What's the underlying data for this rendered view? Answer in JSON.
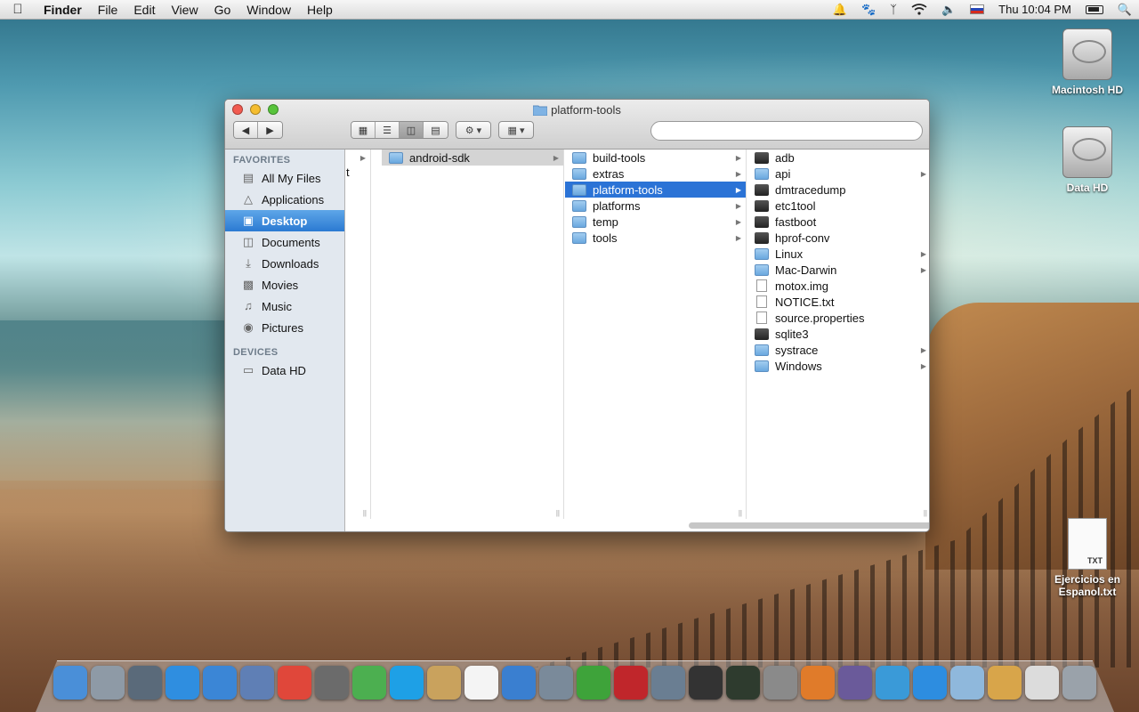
{
  "menubar": {
    "app_name": "Finder",
    "menus": [
      "File",
      "Edit",
      "View",
      "Go",
      "Window",
      "Help"
    ],
    "clock": "Thu 10:04 PM"
  },
  "desktop_icons": [
    {
      "label": "Macintosh HD"
    },
    {
      "label": "Data HD"
    },
    {
      "label": "Ejercicios en Espanol.txt",
      "badge": "TXT"
    }
  ],
  "window": {
    "title": "platform-tools",
    "search_placeholder": ""
  },
  "sidebar": {
    "favorites_header": "FAVORITES",
    "favorites": [
      {
        "label": "All My Files",
        "icon": "all-files-icon"
      },
      {
        "label": "Applications",
        "icon": "applications-icon"
      },
      {
        "label": "Desktop",
        "icon": "desktop-icon",
        "selected": true
      },
      {
        "label": "Documents",
        "icon": "documents-icon"
      },
      {
        "label": "Downloads",
        "icon": "downloads-icon"
      },
      {
        "label": "Movies",
        "icon": "movies-icon"
      },
      {
        "label": "Music",
        "icon": "music-icon"
      },
      {
        "label": "Pictures",
        "icon": "pictures-icon"
      }
    ],
    "devices_header": "DEVICES",
    "devices": [
      {
        "label": "Data HD",
        "icon": "drive-icon"
      }
    ]
  },
  "columns": {
    "col0_stub": "t",
    "col1": [
      {
        "name": "android-sdk",
        "kind": "folder",
        "arrow": true,
        "state": "dim"
      }
    ],
    "col2": [
      {
        "name": "build-tools",
        "kind": "folder",
        "arrow": true
      },
      {
        "name": "extras",
        "kind": "folder",
        "arrow": true
      },
      {
        "name": "platform-tools",
        "kind": "folder",
        "arrow": true,
        "state": "sel"
      },
      {
        "name": "platforms",
        "kind": "folder",
        "arrow": true
      },
      {
        "name": "temp",
        "kind": "folder",
        "arrow": true
      },
      {
        "name": "tools",
        "kind": "folder",
        "arrow": true
      }
    ],
    "col3": [
      {
        "name": "adb",
        "kind": "exec"
      },
      {
        "name": "api",
        "kind": "folder",
        "arrow": true
      },
      {
        "name": "dmtracedump",
        "kind": "exec"
      },
      {
        "name": "etc1tool",
        "kind": "exec"
      },
      {
        "name": "fastboot",
        "kind": "exec"
      },
      {
        "name": "hprof-conv",
        "kind": "exec"
      },
      {
        "name": "Linux",
        "kind": "folder",
        "arrow": true
      },
      {
        "name": "Mac-Darwin",
        "kind": "folder",
        "arrow": true
      },
      {
        "name": "motox.img",
        "kind": "doc"
      },
      {
        "name": "NOTICE.txt",
        "kind": "doc"
      },
      {
        "name": "source.properties",
        "kind": "doc"
      },
      {
        "name": "sqlite3",
        "kind": "exec"
      },
      {
        "name": "systrace",
        "kind": "folder",
        "arrow": true
      },
      {
        "name": "Windows",
        "kind": "folder",
        "arrow": true
      }
    ]
  },
  "dock": [
    {
      "name": "finder",
      "color": "#4a8fd8"
    },
    {
      "name": "launchpad",
      "color": "#8e9aa6"
    },
    {
      "name": "mission-control",
      "color": "#5a6a7a"
    },
    {
      "name": "app-store",
      "color": "#2f8ee0"
    },
    {
      "name": "safari",
      "color": "#3b86d6"
    },
    {
      "name": "preview",
      "color": "#5f7fb5"
    },
    {
      "name": "chrome",
      "color": "#e0473a"
    },
    {
      "name": "facetime",
      "color": "#6b6b6b"
    },
    {
      "name": "android-manager",
      "color": "#4caf50"
    },
    {
      "name": "skype",
      "color": "#1ea0e6"
    },
    {
      "name": "contacts",
      "color": "#c9a25d"
    },
    {
      "name": "calendar",
      "color": "#f4f4f4"
    },
    {
      "name": "itunes",
      "color": "#3a7fd0"
    },
    {
      "name": "sync-app",
      "color": "#7a8a9a"
    },
    {
      "name": "utorrent",
      "color": "#3ea33a"
    },
    {
      "name": "photo-booth",
      "color": "#c0262b"
    },
    {
      "name": "iphoto",
      "color": "#6a7e92"
    },
    {
      "name": "imovie",
      "color": "#333333"
    },
    {
      "name": "activity-monitor",
      "color": "#2e3b2e"
    },
    {
      "name": "system-preferences",
      "color": "#8a8a8a"
    },
    {
      "name": "keynote",
      "color": "#e07b2a"
    },
    {
      "name": "quicktime",
      "color": "#6a5a9a"
    },
    {
      "name": "numbers",
      "color": "#3a9ad8"
    },
    {
      "name": "word",
      "color": "#2d8de0"
    },
    {
      "name": "applications-folder",
      "color": "#8fb8dc"
    },
    {
      "name": "archive",
      "color": "#d8a54a"
    },
    {
      "name": "document-stack",
      "color": "#dcdcdc"
    },
    {
      "name": "trash",
      "color": "#9aa2aa"
    }
  ],
  "colors": {
    "selection": "#2b73d6",
    "sidebar_bg": "#e2e8ef"
  }
}
